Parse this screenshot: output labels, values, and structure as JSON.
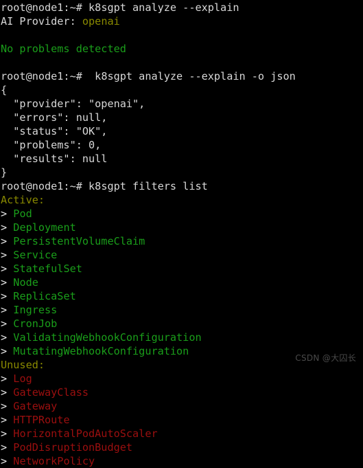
{
  "terminal": {
    "background_color": "#000000",
    "default_text_color": "#d8d8d8",
    "green_color": "#1a9e1a",
    "yellow_color": "#8a8a00",
    "red_color": "#9c0f0f",
    "prompt": "root@node1:~#",
    "commands": {
      "analyze_explain": "k8sgpt analyze --explain",
      "analyze_explain_json": " k8sgpt analyze --explain -o json",
      "filters_list": "k8sgpt filters list"
    },
    "analyze_output": {
      "ai_provider_label": "AI Provider:",
      "ai_provider_value": "openai",
      "status_message": "No problems detected"
    },
    "json_output": {
      "open_brace": "{",
      "close_brace": "}",
      "lines": [
        "  \"provider\": \"openai\",",
        "  \"errors\": null,",
        "  \"status\": \"OK\",",
        "  \"problems\": 0,",
        "  \"results\": null"
      ],
      "fields": {
        "provider": "openai",
        "errors": "null",
        "status": "OK",
        "problems": "0",
        "results": "null"
      }
    },
    "filters": {
      "marker": ">",
      "active_header": "Active:",
      "unused_header": "Unused:",
      "active": [
        "Pod",
        "Deployment",
        "PersistentVolumeClaim",
        "Service",
        "StatefulSet",
        "Node",
        "ReplicaSet",
        "Ingress",
        "CronJob",
        "ValidatingWebhookConfiguration",
        "MutatingWebhookConfiguration"
      ],
      "unused": [
        "Log",
        "GatewayClass",
        "Gateway",
        "HTTPRoute",
        "HorizontalPodAutoScaler",
        "PodDisruptionBudget",
        "NetworkPolicy"
      ]
    },
    "watermark": "CSDN @大囚长"
  }
}
